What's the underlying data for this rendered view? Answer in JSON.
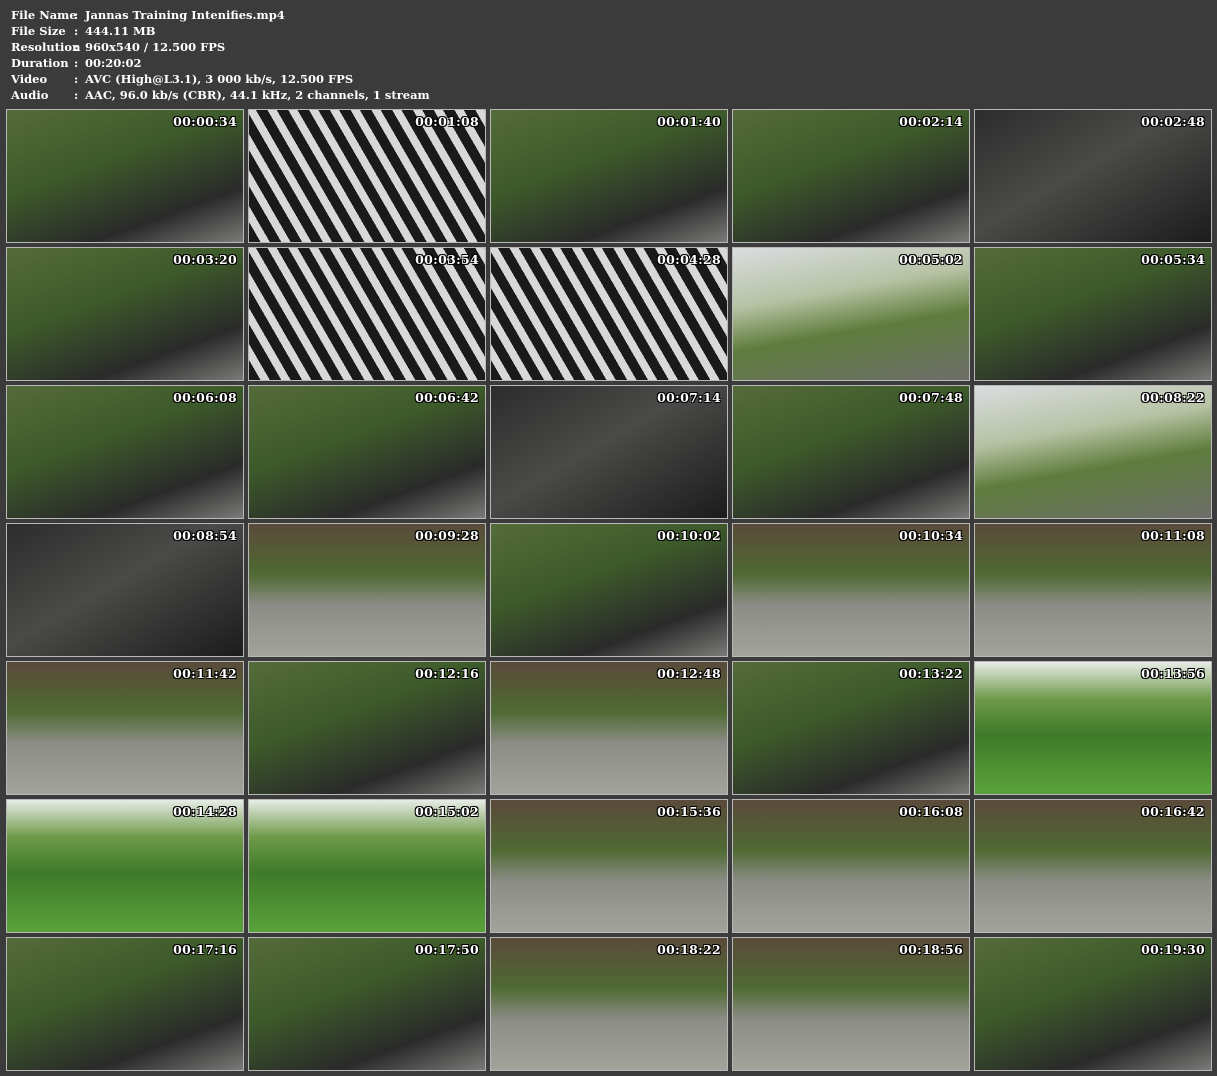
{
  "file_info": [
    {
      "key": "File Name",
      "sep": ":",
      "value": "Jannas Training Intenifies.mp4"
    },
    {
      "key": "File Size",
      "sep": ":",
      "value": "444.11 MB"
    },
    {
      "key": "Resolution",
      "sep": ":",
      "value": "960x540 / 12.500 FPS"
    },
    {
      "key": "Duration",
      "sep": ":",
      "value": "00:20:02"
    },
    {
      "key": "Video",
      "sep": ":",
      "value": "AVC (High@L3.1), 3 000 kb/s, 12.500 FPS"
    },
    {
      "key": "Audio",
      "sep": ":",
      "value": "AAC, 96.0 kb/s (CBR), 44.1 kHz, 2 channels, 1 stream"
    }
  ],
  "thumbnails": [
    {
      "timestamp": "00:00:34",
      "style": "default"
    },
    {
      "timestamp": "00:01:08",
      "style": "stripe"
    },
    {
      "timestamp": "00:01:40",
      "style": "default"
    },
    {
      "timestamp": "00:02:14",
      "style": "default"
    },
    {
      "timestamp": "00:02:48",
      "style": "dark"
    },
    {
      "timestamp": "00:03:20",
      "style": "default"
    },
    {
      "timestamp": "00:03:54",
      "style": "stripe"
    },
    {
      "timestamp": "00:04:28",
      "style": "stripe"
    },
    {
      "timestamp": "00:05:02",
      "style": "light"
    },
    {
      "timestamp": "00:05:34",
      "style": "default"
    },
    {
      "timestamp": "00:06:08",
      "style": "default"
    },
    {
      "timestamp": "00:06:42",
      "style": "default"
    },
    {
      "timestamp": "00:07:14",
      "style": "dark"
    },
    {
      "timestamp": "00:07:48",
      "style": "default"
    },
    {
      "timestamp": "00:08:22",
      "style": "light"
    },
    {
      "timestamp": "00:08:54",
      "style": "dark"
    },
    {
      "timestamp": "00:09:28",
      "style": "court"
    },
    {
      "timestamp": "00:10:02",
      "style": "default"
    },
    {
      "timestamp": "00:10:34",
      "style": "court"
    },
    {
      "timestamp": "00:11:08",
      "style": "court"
    },
    {
      "timestamp": "00:11:42",
      "style": "court"
    },
    {
      "timestamp": "00:12:16",
      "style": "default"
    },
    {
      "timestamp": "00:12:48",
      "style": "court"
    },
    {
      "timestamp": "00:13:22",
      "style": "default"
    },
    {
      "timestamp": "00:13:56",
      "style": "field"
    },
    {
      "timestamp": "00:14:28",
      "style": "field"
    },
    {
      "timestamp": "00:15:02",
      "style": "field"
    },
    {
      "timestamp": "00:15:36",
      "style": "court"
    },
    {
      "timestamp": "00:16:08",
      "style": "court"
    },
    {
      "timestamp": "00:16:42",
      "style": "court"
    },
    {
      "timestamp": "00:17:16",
      "style": "default"
    },
    {
      "timestamp": "00:17:50",
      "style": "default"
    },
    {
      "timestamp": "00:18:22",
      "style": "court"
    },
    {
      "timestamp": "00:18:56",
      "style": "court"
    },
    {
      "timestamp": "00:19:30",
      "style": "default"
    }
  ]
}
